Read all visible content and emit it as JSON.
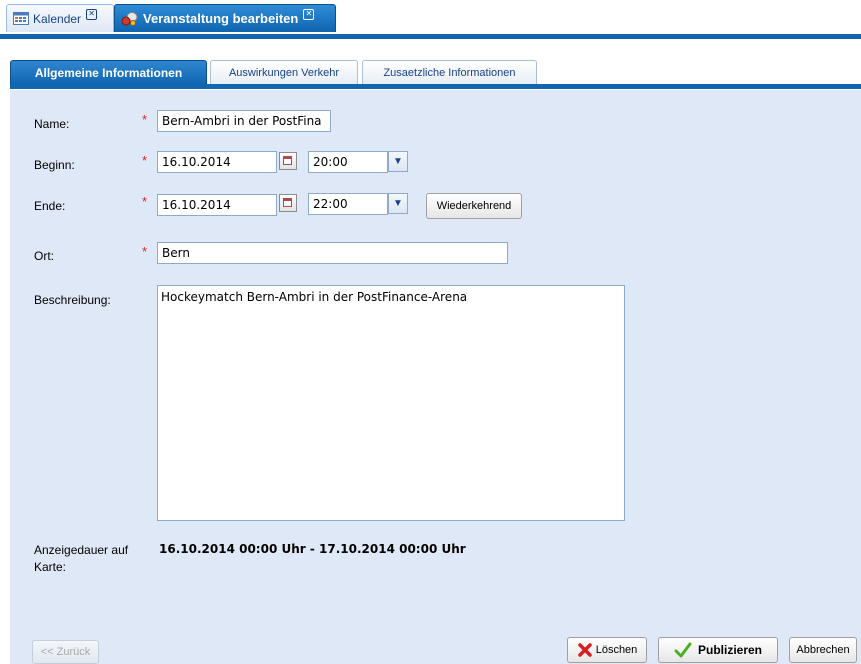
{
  "app_tabs": [
    {
      "label": "Kalender",
      "icon": "calendar-icon",
      "close_icon": "close-icon"
    },
    {
      "label": "Veranstaltung bearbeiten",
      "icon": "event-icon",
      "close_icon": "close-icon"
    }
  ],
  "tabs": [
    {
      "label": "Allgemeine Informationen",
      "active": true
    },
    {
      "label": "Auswirkungen Verkehr",
      "active": false
    },
    {
      "label": "Zusaetzliche Informationen",
      "active": false
    }
  ],
  "form": {
    "required_marker": "*",
    "name": {
      "label": "Name:",
      "value": "Bern-Ambri in der PostFina"
    },
    "beginn": {
      "label": "Beginn:",
      "date": "16.10.2014",
      "time": "20:00"
    },
    "ende": {
      "label": "Ende:",
      "date": "16.10.2014",
      "time": "22:00"
    },
    "recurring_button": "Wiederkehrend",
    "ort": {
      "label": "Ort:",
      "value": "Bern"
    },
    "beschreibung": {
      "label": "Beschreibung:",
      "value": "Hockeymatch Bern-Ambri in der PostFinance-Arena"
    },
    "display_duration": {
      "label": "Anzeigedauer auf Karte:",
      "value": "16.10.2014 00:00 Uhr - 17.10.2014 00:00 Uhr"
    }
  },
  "footer": {
    "back": "<< Zurück",
    "delete": "Löschen",
    "publish": "Publizieren",
    "cancel": "Abbrechen"
  },
  "colors": {
    "accent": "#1166b2",
    "panel": "#dfe8f6",
    "required": "#e02020",
    "publish_check": "#4caf20",
    "delete_x": "#d62020"
  }
}
